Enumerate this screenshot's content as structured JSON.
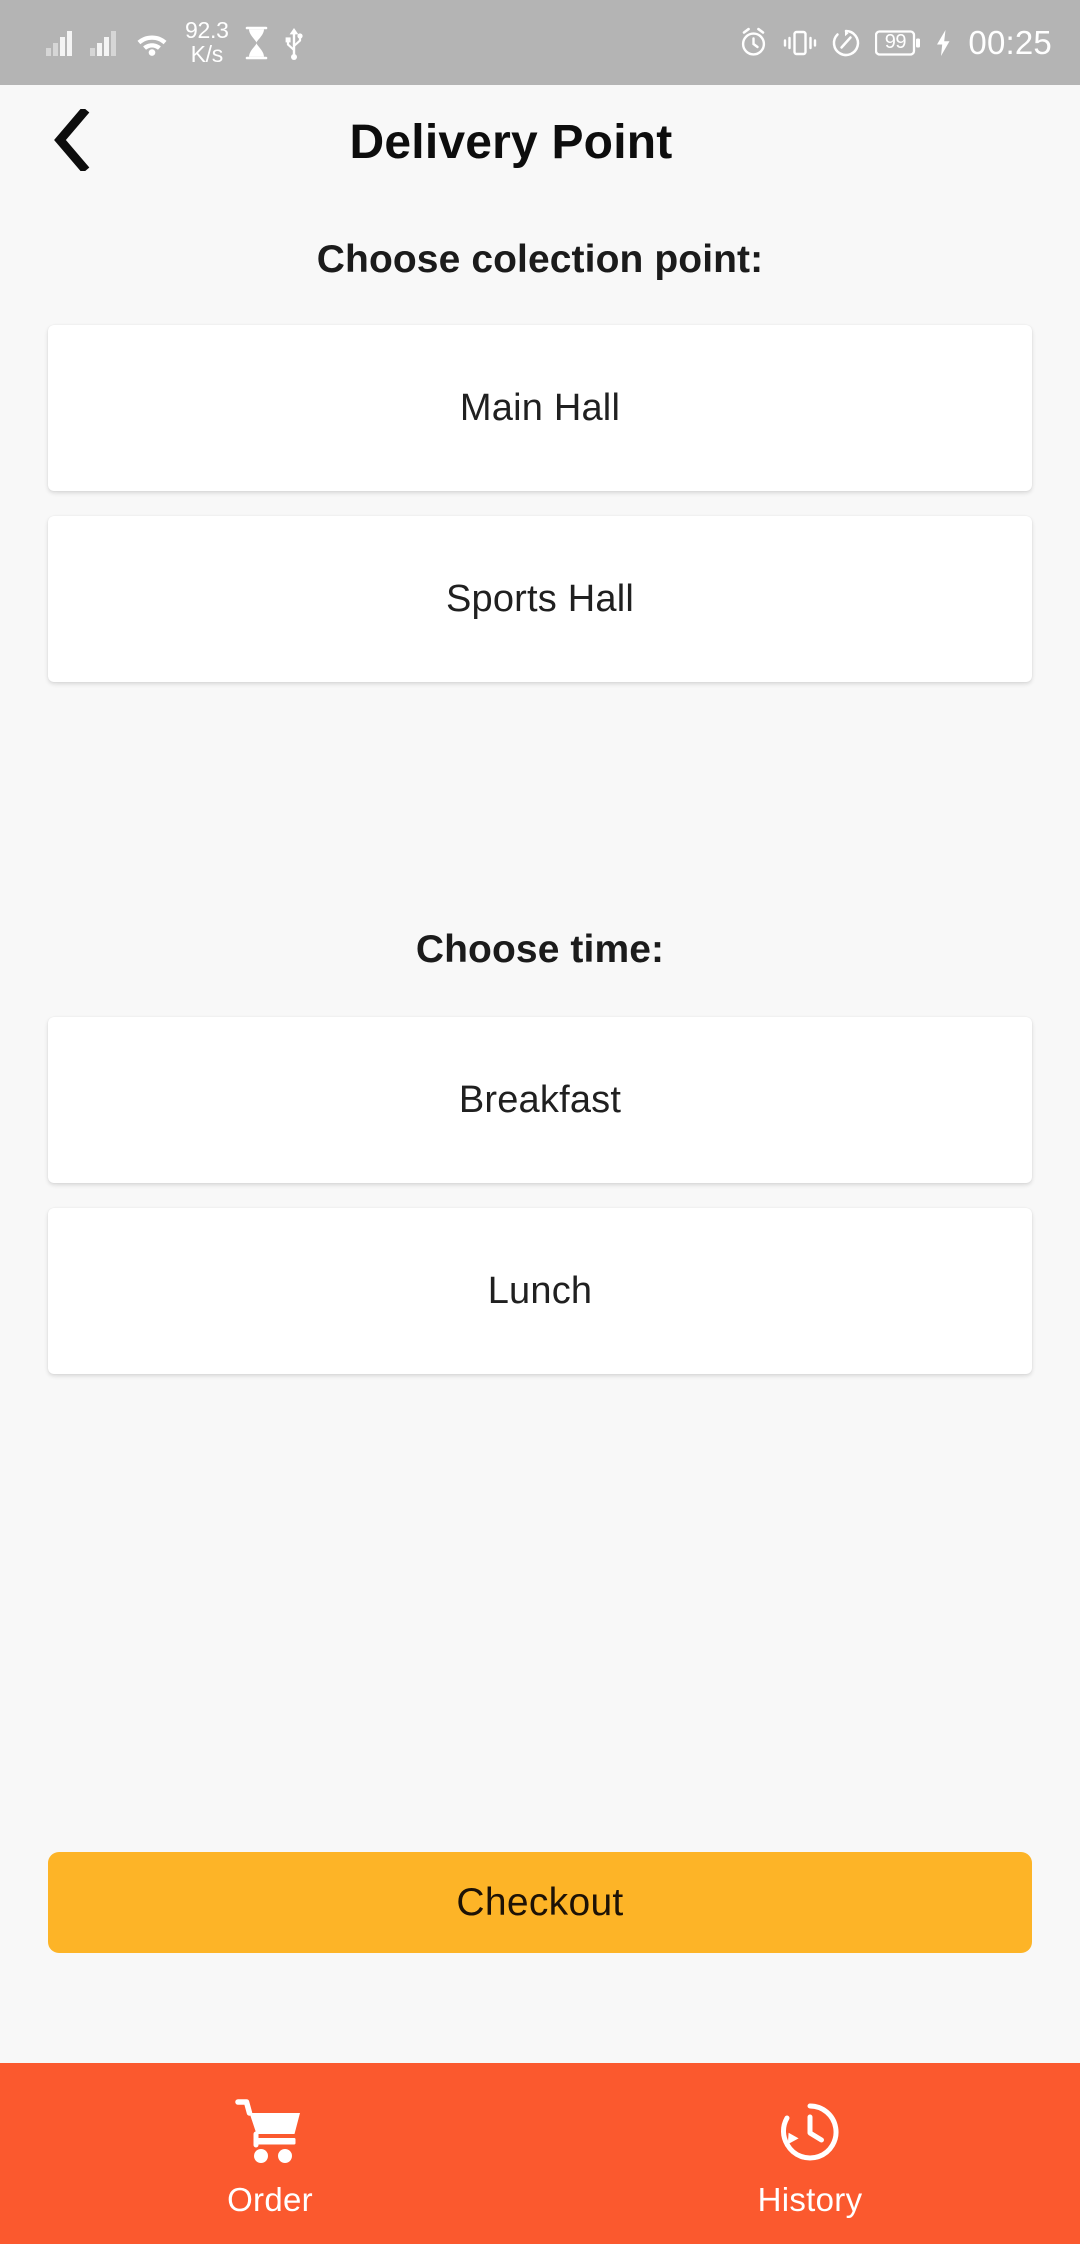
{
  "status_bar": {
    "network_speed_value": "92.3",
    "network_speed_unit": "K/s",
    "battery_level": "99",
    "clock": "00:25",
    "icons_left": [
      "signal-bars-sim1-icon",
      "signal-bars-sim2-icon",
      "wifi-icon",
      "hourglass-icon",
      "usb-icon"
    ],
    "icons_right": [
      "alarm-icon",
      "vibrate-icon",
      "sync-icon",
      "battery-icon",
      "charging-bolt-icon"
    ],
    "background_color": "#b4b4b4",
    "foreground_color": "#ffffff"
  },
  "app_bar": {
    "title": "Delivery Point",
    "back_icon": "chevron-left-icon"
  },
  "collection_section": {
    "heading": "Choose colection point:",
    "options": [
      {
        "label": "Main Hall"
      },
      {
        "label": "Sports Hall"
      }
    ]
  },
  "time_section": {
    "heading": "Choose time:",
    "options": [
      {
        "label": "Breakfast"
      },
      {
        "label": "Lunch"
      }
    ]
  },
  "checkout": {
    "label": "Checkout",
    "color": "#fdb427"
  },
  "bottom_nav": {
    "background_color": "#fb592e",
    "items": [
      {
        "label": "Order",
        "icon": "shopping-cart-icon"
      },
      {
        "label": "History",
        "icon": "history-clock-icon"
      }
    ]
  },
  "theme": {
    "page_background": "#f8f8f8",
    "card_background": "#ffffff",
    "text_primary": "#1b1b1b"
  }
}
